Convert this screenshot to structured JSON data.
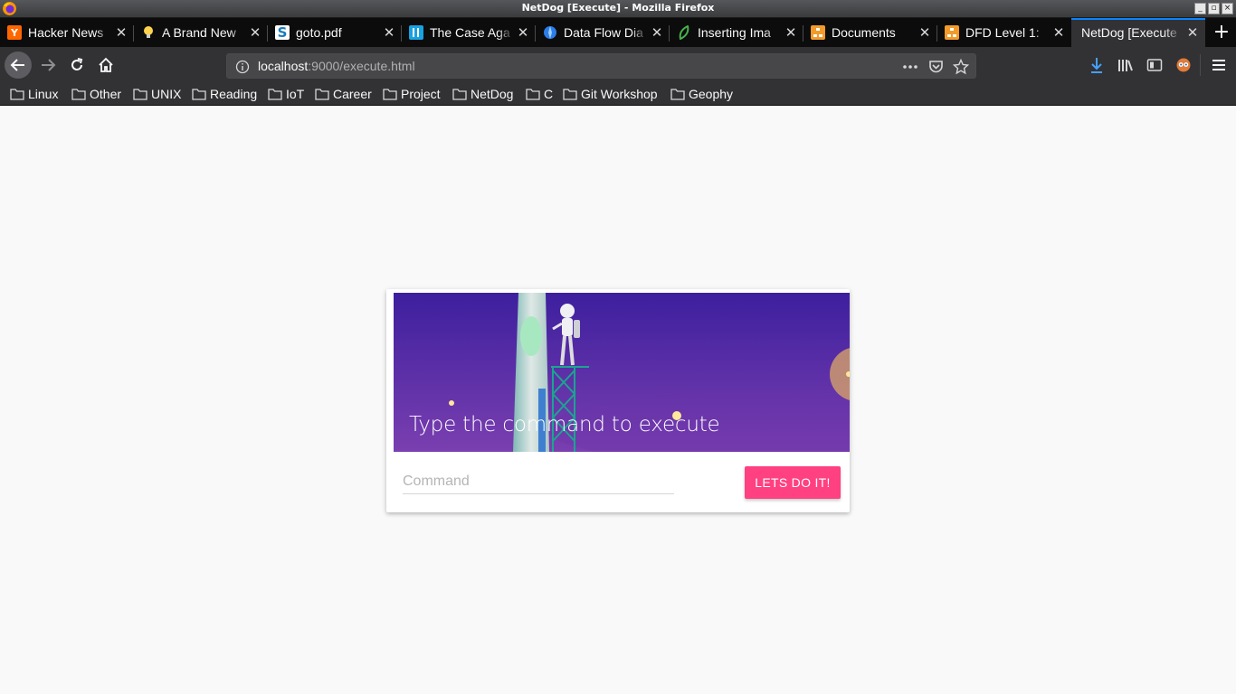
{
  "window": {
    "title": "NetDog [Execute] - Mozilla Firefox",
    "buttons": [
      "_",
      "▫",
      "×"
    ]
  },
  "tabs": [
    {
      "label": "Hacker News",
      "favicon": "ycombinator-icon",
      "favicon_text": "Y",
      "favicon_color": "#ff6600"
    },
    {
      "label": "A Brand New",
      "favicon": "lightbulb-icon",
      "favicon_text": "",
      "favicon_color": "#ffd34d"
    },
    {
      "label": "goto.pdf",
      "favicon": "scribd-icon",
      "favicon_text": "S",
      "favicon_color": "#1a7bba"
    },
    {
      "label": "The Case Aga",
      "favicon": "blue-square-icon",
      "favicon_text": "",
      "favicon_color": "#1aa1e0"
    },
    {
      "label": "Data Flow Dia",
      "favicon": "globe-icon",
      "favicon_text": "",
      "favicon_color": "#2b7de9"
    },
    {
      "label": "Inserting Ima",
      "favicon": "leaf-icon",
      "favicon_text": "",
      "favicon_color": "#47b04b"
    },
    {
      "label": "Documents",
      "favicon": "drawio-icon",
      "favicon_text": "",
      "favicon_color": "#f29b2b"
    },
    {
      "label": "DFD Level 1:",
      "favicon": "drawio-icon",
      "favicon_text": "",
      "favicon_color": "#f29b2b"
    },
    {
      "label": "NetDog [Execute",
      "favicon": "none",
      "favicon_text": "",
      "favicon_color": "",
      "active": true
    }
  ],
  "newtab_label": "+",
  "tab_close_glyph": "✕",
  "url": {
    "host": "localhost",
    "rest": ":9000/execute.html"
  },
  "bookmarks": [
    "Linux",
    "Other",
    "UNIX",
    "Reading",
    "IoT",
    "Career",
    "Project",
    "NetDog",
    "C",
    "Git Workshop",
    "Geophy"
  ],
  "card": {
    "title": "Type the command to execute",
    "input_placeholder": "Command",
    "input_value": "",
    "button_label": "LETS DO IT!"
  },
  "colors": {
    "accent_button": "#ff4081",
    "hero_top": "#3d1f9e",
    "hero_bottom": "#7a3fb0",
    "tab_highlight": "#0a84ff"
  }
}
